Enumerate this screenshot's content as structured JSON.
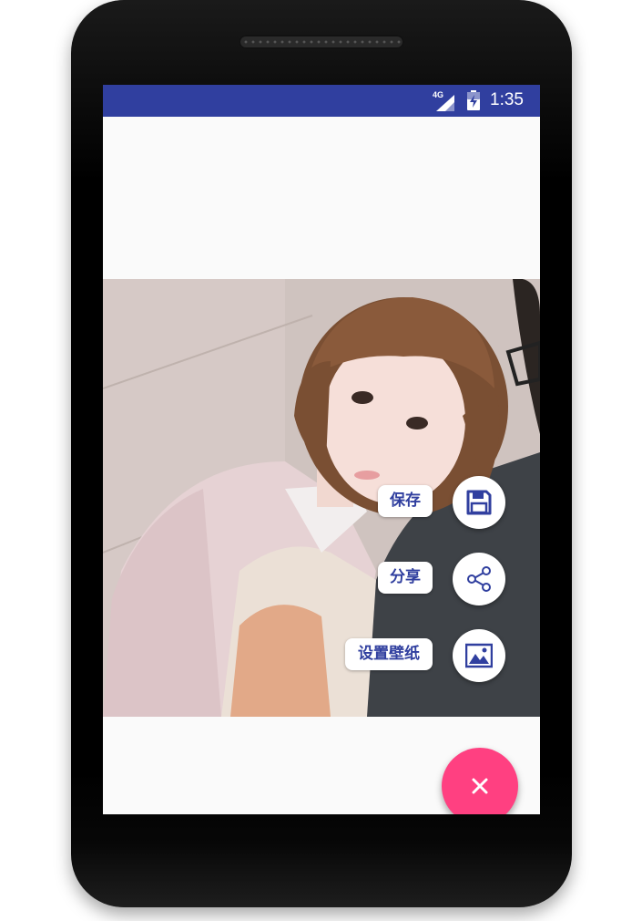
{
  "status_bar": {
    "network": "4G",
    "time": "1:35",
    "color": "#303f9f"
  },
  "photo": {
    "subject": "portrait-photo"
  },
  "fab_menu": {
    "items": [
      {
        "label": "保存",
        "icon": "save-icon"
      },
      {
        "label": "分享",
        "icon": "share-icon"
      },
      {
        "label": "设置壁纸",
        "icon": "image-icon"
      }
    ],
    "main_icon": "close-icon",
    "main_color": "#ff4081",
    "accent_color": "#303f9f"
  }
}
